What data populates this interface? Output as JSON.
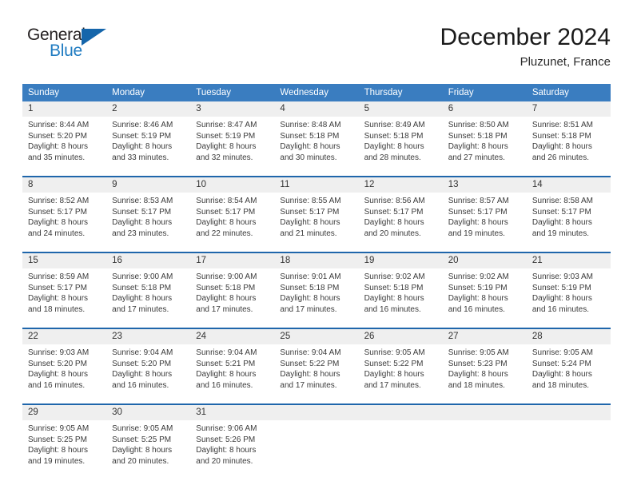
{
  "logo": {
    "word_top": "General",
    "word_bottom": "Blue",
    "triangle_color": "#1566ab",
    "blue_text_color": "#1f7bc1"
  },
  "header": {
    "title": "December 2024",
    "subtitle": "Pluzunet, France"
  },
  "theme": {
    "header_bg": "#3a7dc0",
    "separator_line": "#1f66ab",
    "daynum_bg": "#efefef"
  },
  "calendar": {
    "weekday_headers": [
      "Sunday",
      "Monday",
      "Tuesday",
      "Wednesday",
      "Thursday",
      "Friday",
      "Saturday"
    ],
    "weeks": [
      [
        {
          "day": "1",
          "sunrise": "Sunrise: 8:44 AM",
          "sunset": "Sunset: 5:20 PM",
          "daylight_line1": "Daylight: 8 hours",
          "daylight_line2": "and 35 minutes."
        },
        {
          "day": "2",
          "sunrise": "Sunrise: 8:46 AM",
          "sunset": "Sunset: 5:19 PM",
          "daylight_line1": "Daylight: 8 hours",
          "daylight_line2": "and 33 minutes."
        },
        {
          "day": "3",
          "sunrise": "Sunrise: 8:47 AM",
          "sunset": "Sunset: 5:19 PM",
          "daylight_line1": "Daylight: 8 hours",
          "daylight_line2": "and 32 minutes."
        },
        {
          "day": "4",
          "sunrise": "Sunrise: 8:48 AM",
          "sunset": "Sunset: 5:18 PM",
          "daylight_line1": "Daylight: 8 hours",
          "daylight_line2": "and 30 minutes."
        },
        {
          "day": "5",
          "sunrise": "Sunrise: 8:49 AM",
          "sunset": "Sunset: 5:18 PM",
          "daylight_line1": "Daylight: 8 hours",
          "daylight_line2": "and 28 minutes."
        },
        {
          "day": "6",
          "sunrise": "Sunrise: 8:50 AM",
          "sunset": "Sunset: 5:18 PM",
          "daylight_line1": "Daylight: 8 hours",
          "daylight_line2": "and 27 minutes."
        },
        {
          "day": "7",
          "sunrise": "Sunrise: 8:51 AM",
          "sunset": "Sunset: 5:18 PM",
          "daylight_line1": "Daylight: 8 hours",
          "daylight_line2": "and 26 minutes."
        }
      ],
      [
        {
          "day": "8",
          "sunrise": "Sunrise: 8:52 AM",
          "sunset": "Sunset: 5:17 PM",
          "daylight_line1": "Daylight: 8 hours",
          "daylight_line2": "and 24 minutes."
        },
        {
          "day": "9",
          "sunrise": "Sunrise: 8:53 AM",
          "sunset": "Sunset: 5:17 PM",
          "daylight_line1": "Daylight: 8 hours",
          "daylight_line2": "and 23 minutes."
        },
        {
          "day": "10",
          "sunrise": "Sunrise: 8:54 AM",
          "sunset": "Sunset: 5:17 PM",
          "daylight_line1": "Daylight: 8 hours",
          "daylight_line2": "and 22 minutes."
        },
        {
          "day": "11",
          "sunrise": "Sunrise: 8:55 AM",
          "sunset": "Sunset: 5:17 PM",
          "daylight_line1": "Daylight: 8 hours",
          "daylight_line2": "and 21 minutes."
        },
        {
          "day": "12",
          "sunrise": "Sunrise: 8:56 AM",
          "sunset": "Sunset: 5:17 PM",
          "daylight_line1": "Daylight: 8 hours",
          "daylight_line2": "and 20 minutes."
        },
        {
          "day": "13",
          "sunrise": "Sunrise: 8:57 AM",
          "sunset": "Sunset: 5:17 PM",
          "daylight_line1": "Daylight: 8 hours",
          "daylight_line2": "and 19 minutes."
        },
        {
          "day": "14",
          "sunrise": "Sunrise: 8:58 AM",
          "sunset": "Sunset: 5:17 PM",
          "daylight_line1": "Daylight: 8 hours",
          "daylight_line2": "and 19 minutes."
        }
      ],
      [
        {
          "day": "15",
          "sunrise": "Sunrise: 8:59 AM",
          "sunset": "Sunset: 5:17 PM",
          "daylight_line1": "Daylight: 8 hours",
          "daylight_line2": "and 18 minutes."
        },
        {
          "day": "16",
          "sunrise": "Sunrise: 9:00 AM",
          "sunset": "Sunset: 5:18 PM",
          "daylight_line1": "Daylight: 8 hours",
          "daylight_line2": "and 17 minutes."
        },
        {
          "day": "17",
          "sunrise": "Sunrise: 9:00 AM",
          "sunset": "Sunset: 5:18 PM",
          "daylight_line1": "Daylight: 8 hours",
          "daylight_line2": "and 17 minutes."
        },
        {
          "day": "18",
          "sunrise": "Sunrise: 9:01 AM",
          "sunset": "Sunset: 5:18 PM",
          "daylight_line1": "Daylight: 8 hours",
          "daylight_line2": "and 17 minutes."
        },
        {
          "day": "19",
          "sunrise": "Sunrise: 9:02 AM",
          "sunset": "Sunset: 5:18 PM",
          "daylight_line1": "Daylight: 8 hours",
          "daylight_line2": "and 16 minutes."
        },
        {
          "day": "20",
          "sunrise": "Sunrise: 9:02 AM",
          "sunset": "Sunset: 5:19 PM",
          "daylight_line1": "Daylight: 8 hours",
          "daylight_line2": "and 16 minutes."
        },
        {
          "day": "21",
          "sunrise": "Sunrise: 9:03 AM",
          "sunset": "Sunset: 5:19 PM",
          "daylight_line1": "Daylight: 8 hours",
          "daylight_line2": "and 16 minutes."
        }
      ],
      [
        {
          "day": "22",
          "sunrise": "Sunrise: 9:03 AM",
          "sunset": "Sunset: 5:20 PM",
          "daylight_line1": "Daylight: 8 hours",
          "daylight_line2": "and 16 minutes."
        },
        {
          "day": "23",
          "sunrise": "Sunrise: 9:04 AM",
          "sunset": "Sunset: 5:20 PM",
          "daylight_line1": "Daylight: 8 hours",
          "daylight_line2": "and 16 minutes."
        },
        {
          "day": "24",
          "sunrise": "Sunrise: 9:04 AM",
          "sunset": "Sunset: 5:21 PM",
          "daylight_line1": "Daylight: 8 hours",
          "daylight_line2": "and 16 minutes."
        },
        {
          "day": "25",
          "sunrise": "Sunrise: 9:04 AM",
          "sunset": "Sunset: 5:22 PM",
          "daylight_line1": "Daylight: 8 hours",
          "daylight_line2": "and 17 minutes."
        },
        {
          "day": "26",
          "sunrise": "Sunrise: 9:05 AM",
          "sunset": "Sunset: 5:22 PM",
          "daylight_line1": "Daylight: 8 hours",
          "daylight_line2": "and 17 minutes."
        },
        {
          "day": "27",
          "sunrise": "Sunrise: 9:05 AM",
          "sunset": "Sunset: 5:23 PM",
          "daylight_line1": "Daylight: 8 hours",
          "daylight_line2": "and 18 minutes."
        },
        {
          "day": "28",
          "sunrise": "Sunrise: 9:05 AM",
          "sunset": "Sunset: 5:24 PM",
          "daylight_line1": "Daylight: 8 hours",
          "daylight_line2": "and 18 minutes."
        }
      ],
      [
        {
          "day": "29",
          "sunrise": "Sunrise: 9:05 AM",
          "sunset": "Sunset: 5:25 PM",
          "daylight_line1": "Daylight: 8 hours",
          "daylight_line2": "and 19 minutes."
        },
        {
          "day": "30",
          "sunrise": "Sunrise: 9:05 AM",
          "sunset": "Sunset: 5:25 PM",
          "daylight_line1": "Daylight: 8 hours",
          "daylight_line2": "and 20 minutes."
        },
        {
          "day": "31",
          "sunrise": "Sunrise: 9:06 AM",
          "sunset": "Sunset: 5:26 PM",
          "daylight_line1": "Daylight: 8 hours",
          "daylight_line2": "and 20 minutes."
        },
        {
          "day": "",
          "sunrise": "",
          "sunset": "",
          "daylight_line1": "",
          "daylight_line2": ""
        },
        {
          "day": "",
          "sunrise": "",
          "sunset": "",
          "daylight_line1": "",
          "daylight_line2": ""
        },
        {
          "day": "",
          "sunrise": "",
          "sunset": "",
          "daylight_line1": "",
          "daylight_line2": ""
        },
        {
          "day": "",
          "sunrise": "",
          "sunset": "",
          "daylight_line1": "",
          "daylight_line2": ""
        }
      ]
    ]
  }
}
